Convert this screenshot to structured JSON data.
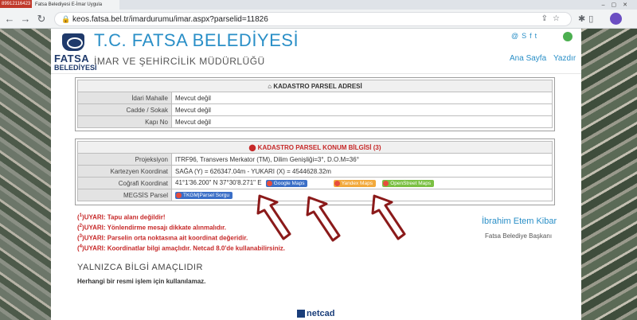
{
  "browser": {
    "tab_id": "89912116423",
    "tab_title": "Fatsa Belediyesi E-İmar Uygula",
    "url": "keos.fatsa.bel.tr/imardurumu/imar.aspx?parselid=11826"
  },
  "header": {
    "logo_line1": "FATSA",
    "logo_line2": "BELEDİYESİ",
    "title": "T.C. FATSA BELEDİYESİ",
    "subtitle": "İMAR VE ŞEHİRCİLİK MÜDÜRLÜĞÜ",
    "nav": {
      "home": "Ana Sayfa",
      "print": "Yazdır"
    },
    "social_icons": [
      "at-icon",
      "skype-icon",
      "facebook-icon",
      "twitter-icon"
    ]
  },
  "address_table": {
    "title": "KADASTRO PARSEL ADRESİ",
    "rows": [
      {
        "label": "İdari Mahalle",
        "value": "Mevcut değil"
      },
      {
        "label": "Cadde / Sokak",
        "value": "Mevcut değil"
      },
      {
        "label": "Kapı No",
        "value": "Mevcut değil"
      }
    ]
  },
  "location_table": {
    "title": "KADASTRO PARSEL KONUM BİLGİSİ",
    "title_note": "(3)",
    "rows": [
      {
        "label": "Projeksiyon",
        "value": "ITRF96, Transvers Merkator (TM), Dilim Genişliği=3°, D.O.M=36°"
      },
      {
        "label": "Kartezyen Koordinat",
        "value": "SAĞA (Y) = 626347.04m - YUKARI (X) = 4544628.32m"
      },
      {
        "label": "Coğrafi Koordinat",
        "value": "41°1'36.200\" N 37°30'8.271\" E"
      },
      {
        "label": "MEGSİS Parsel",
        "value": ""
      }
    ],
    "map_buttons": {
      "google": "Google Maps",
      "yandex": "Yandex Maps",
      "osm": "OpenStreet Maps"
    },
    "tkgm_button": "TKGM|Parsel Sorgu"
  },
  "warnings": [
    {
      "num": "1",
      "text": "UYARI: Tapu alanı değildir!"
    },
    {
      "num": "2",
      "text": "UYARI: Yönlendirme mesajı dikkate alınmalıdır."
    },
    {
      "num": "3",
      "text": "UYARI: Parselin orta noktasına ait koordinat değeridir."
    },
    {
      "num": "4",
      "text": "UYARI: Koordinatlar bilgi amaçlıdır. Netcad 8.0'de kullanabilirsiniz."
    }
  ],
  "mayor": {
    "name": "İbrahim Etem Kibar",
    "title": "Fatsa Belediye Başkanı"
  },
  "disclaimer": {
    "heading": "YALNIZCA BİLGİ AMAÇLIDIR",
    "text": "Herhangi bir resmi işlem için kullanılamaz."
  },
  "footer": {
    "brand": "netcad"
  },
  "colors": {
    "accent": "#2a8fc7",
    "warning": "#c62828",
    "arrow": "#8b1a1a"
  }
}
